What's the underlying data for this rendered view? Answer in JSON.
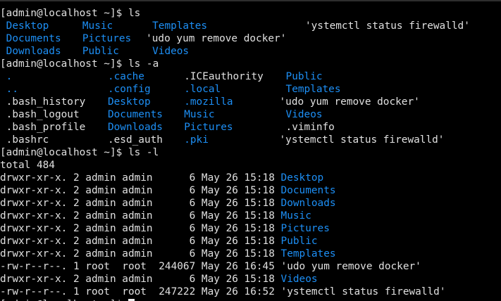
{
  "colors": {
    "background": "#000000",
    "foreground": "#e0e0e0",
    "directory": "#1d8ff5"
  },
  "lines": [
    {
      "type": "prompt",
      "text": "[admin@localhost ~]$ ls"
    },
    {
      "type": "cols",
      "cells": [
        {
          "col": 0,
          "text": " Desktop",
          "kind": "dir"
        },
        {
          "col": 12,
          "text": " Music",
          "kind": "dir"
        },
        {
          "col": 23,
          "text": " Templates",
          "kind": "dir"
        },
        {
          "col": 48,
          "text": "'ystemctl status firewalld'",
          "kind": "reg"
        }
      ]
    },
    {
      "type": "cols",
      "cells": [
        {
          "col": 0,
          "text": " Documents",
          "kind": "dir"
        },
        {
          "col": 12,
          "text": " Pictures",
          "kind": "dir"
        },
        {
          "col": 22,
          "text": " 'udo yum remove docker'",
          "kind": "reg"
        }
      ]
    },
    {
      "type": "cols",
      "cells": [
        {
          "col": 0,
          "text": " Downloads",
          "kind": "dir"
        },
        {
          "col": 12,
          "text": " Public",
          "kind": "dir"
        },
        {
          "col": 23,
          "text": " Videos",
          "kind": "dir"
        }
      ]
    },
    {
      "type": "prompt",
      "text": "[admin@localhost ~]$ ls -a"
    },
    {
      "type": "cols",
      "cells": [
        {
          "col": 0,
          "text": " .",
          "kind": "dir"
        },
        {
          "col": 16,
          "text": " .cache",
          "kind": "dir"
        },
        {
          "col": 28,
          "text": " .ICEauthority",
          "kind": "reg"
        },
        {
          "col": 44,
          "text": " Public",
          "kind": "dir"
        }
      ]
    },
    {
      "type": "cols",
      "cells": [
        {
          "col": 0,
          "text": " ..",
          "kind": "dir"
        },
        {
          "col": 16,
          "text": " .config",
          "kind": "dir"
        },
        {
          "col": 28,
          "text": " .local",
          "kind": "dir"
        },
        {
          "col": 44,
          "text": " Templates",
          "kind": "dir"
        }
      ]
    },
    {
      "type": "cols",
      "cells": [
        {
          "col": 0,
          "text": " .bash_history",
          "kind": "reg"
        },
        {
          "col": 16,
          "text": " Desktop",
          "kind": "dir"
        },
        {
          "col": 28,
          "text": " .mozilla",
          "kind": "dir"
        },
        {
          "col": 43,
          "text": " 'udo yum remove docker'",
          "kind": "reg"
        }
      ]
    },
    {
      "type": "cols",
      "cells": [
        {
          "col": 0,
          "text": " .bash_logout",
          "kind": "reg"
        },
        {
          "col": 16,
          "text": " Documents",
          "kind": "dir"
        },
        {
          "col": 28,
          "text": " Music",
          "kind": "dir"
        },
        {
          "col": 44,
          "text": " Videos",
          "kind": "dir"
        }
      ]
    },
    {
      "type": "cols",
      "cells": [
        {
          "col": 0,
          "text": " .bash_profile",
          "kind": "reg"
        },
        {
          "col": 16,
          "text": " Downloads",
          "kind": "dir"
        },
        {
          "col": 28,
          "text": " Pictures",
          "kind": "dir"
        },
        {
          "col": 44,
          "text": " .viminfo",
          "kind": "reg"
        }
      ]
    },
    {
      "type": "cols",
      "cells": [
        {
          "col": 0,
          "text": " .bashrc",
          "kind": "reg"
        },
        {
          "col": 16,
          "text": " .esd_auth",
          "kind": "reg"
        },
        {
          "col": 28,
          "text": " .pki",
          "kind": "dir"
        },
        {
          "col": 43,
          "text": " 'ystemctl status firewalld'",
          "kind": "reg"
        }
      ]
    },
    {
      "type": "prompt",
      "text": "[admin@localhost ~]$ ls -l"
    },
    {
      "type": "plain",
      "text": "total 484"
    },
    {
      "type": "longlist",
      "meta": "drwxr-xr-x. 2 admin admin      6 May 26 15:18",
      "name": " Desktop",
      "kind": "dir"
    },
    {
      "type": "longlist",
      "meta": "drwxr-xr-x. 2 admin admin      6 May 26 15:18",
      "name": " Documents",
      "kind": "dir"
    },
    {
      "type": "longlist",
      "meta": "drwxr-xr-x. 2 admin admin      6 May 26 15:18",
      "name": " Downloads",
      "kind": "dir"
    },
    {
      "type": "longlist",
      "meta": "drwxr-xr-x. 2 admin admin      6 May 26 15:18",
      "name": " Music",
      "kind": "dir"
    },
    {
      "type": "longlist",
      "meta": "drwxr-xr-x. 2 admin admin      6 May 26 15:18",
      "name": " Pictures",
      "kind": "dir"
    },
    {
      "type": "longlist",
      "meta": "drwxr-xr-x. 2 admin admin      6 May 26 15:18",
      "name": " Public",
      "kind": "dir"
    },
    {
      "type": "longlist",
      "meta": "drwxr-xr-x. 2 admin admin      6 May 26 15:18",
      "name": " Templates",
      "kind": "dir"
    },
    {
      "type": "longlist",
      "meta": "-rw-r--r--. 1 root  root  244067 May 26 16:45",
      "name": " 'udo yum remove docker'",
      "kind": "reg"
    },
    {
      "type": "longlist",
      "meta": "drwxr-xr-x. 2 admin admin      6 May 26 15:18",
      "name": " Videos",
      "kind": "dir"
    },
    {
      "type": "longlist",
      "meta": "-rw-r--r--. 1 root  root  247222 May 26 16:52",
      "name": " 'ystemctl status firewalld'",
      "kind": "reg"
    },
    {
      "type": "cursorline",
      "text": "[admin@localhost ~]$ "
    }
  ]
}
